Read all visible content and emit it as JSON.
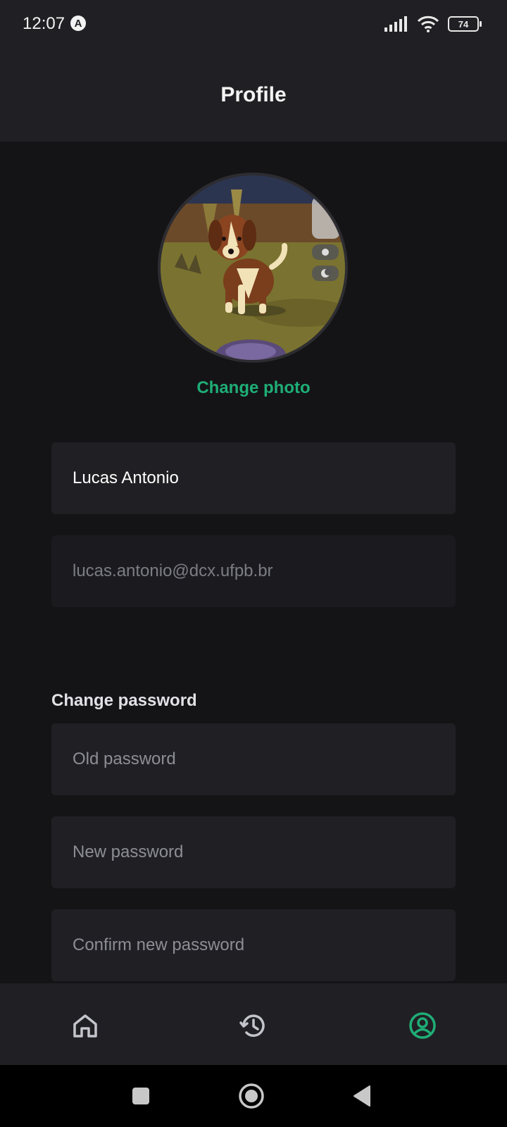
{
  "status_bar": {
    "time": "12:07",
    "notification_badge": "A",
    "battery_level": "74",
    "icons": [
      "signal-icon",
      "wifi-icon",
      "battery-icon"
    ]
  },
  "header": {
    "title": "Profile"
  },
  "profile": {
    "change_photo_label": "Change photo",
    "name_value": "Lucas Antonio",
    "email_value": "lucas.antonio@dcx.ufpb.br"
  },
  "password": {
    "section_label": "Change password",
    "old_placeholder": "Old password",
    "new_placeholder": "New password",
    "confirm_placeholder": "Confirm new password"
  },
  "bottom_nav": {
    "items": [
      {
        "icon": "home-icon",
        "active": false
      },
      {
        "icon": "history-icon",
        "active": false
      },
      {
        "icon": "profile-icon",
        "active": true
      }
    ]
  },
  "colors": {
    "accent": "#1fae76",
    "background": "#141417",
    "surface": "#202024",
    "inactive_icon": "#c4c4cc"
  }
}
